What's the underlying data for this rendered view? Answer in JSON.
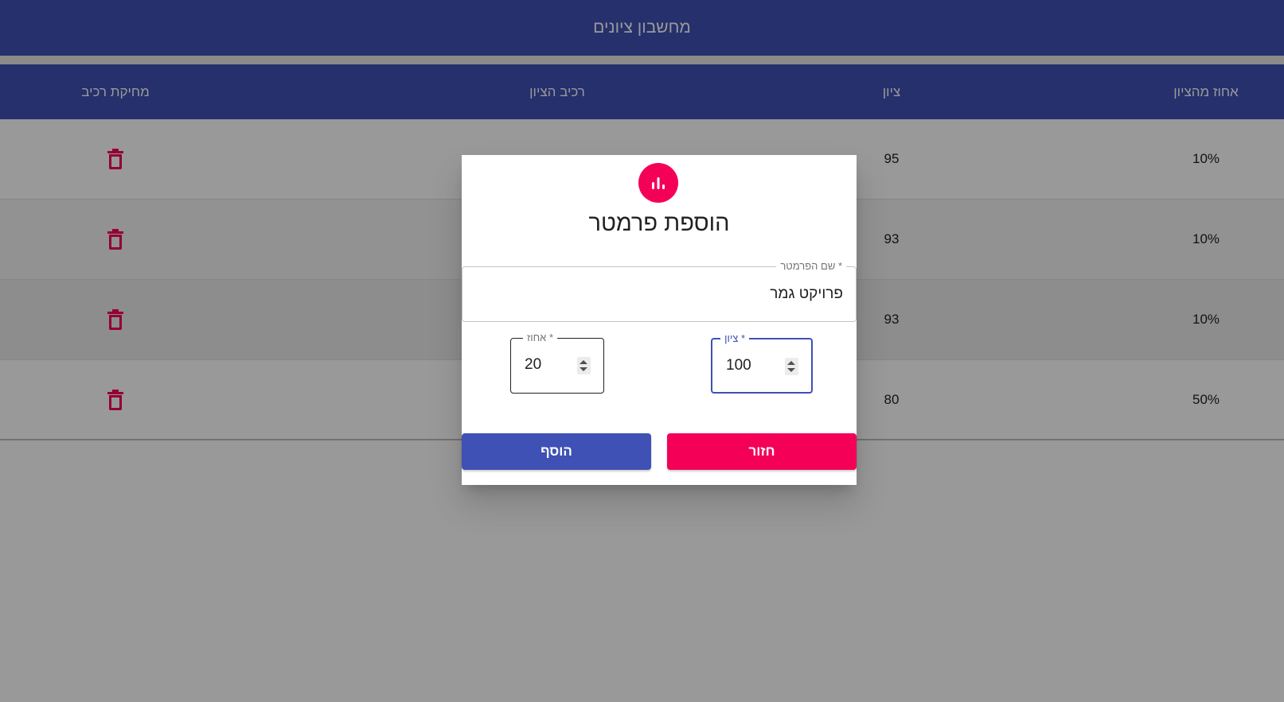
{
  "app": {
    "title": "מחשבון ציונים"
  },
  "colors": {
    "primary": "#3f51b5",
    "accent": "#f50057"
  },
  "table": {
    "headers": {
      "percent": "אחוז מהציון",
      "grade": "ציון",
      "component": "רכיב הציון",
      "delete": "מחיקת רכיב"
    },
    "rows": [
      {
        "percent": "10%",
        "grade": "95",
        "component": ""
      },
      {
        "percent": "10%",
        "grade": "93",
        "component": ""
      },
      {
        "percent": "10%",
        "grade": "93",
        "component": ""
      },
      {
        "percent": "50%",
        "grade": "80",
        "component": ""
      }
    ],
    "delete_icon": "trash-icon"
  },
  "dialog": {
    "icon": "bar-chart-icon",
    "title": "הוספת פרמטר",
    "name_field": {
      "label": "שם הפרמטר *",
      "value": "פרויקט גמר"
    },
    "percent_field": {
      "label": "אחוז *",
      "value": "20"
    },
    "grade_field": {
      "label": "ציון *",
      "value": "100"
    },
    "add_label": "הוסף",
    "back_label": "חזור"
  }
}
